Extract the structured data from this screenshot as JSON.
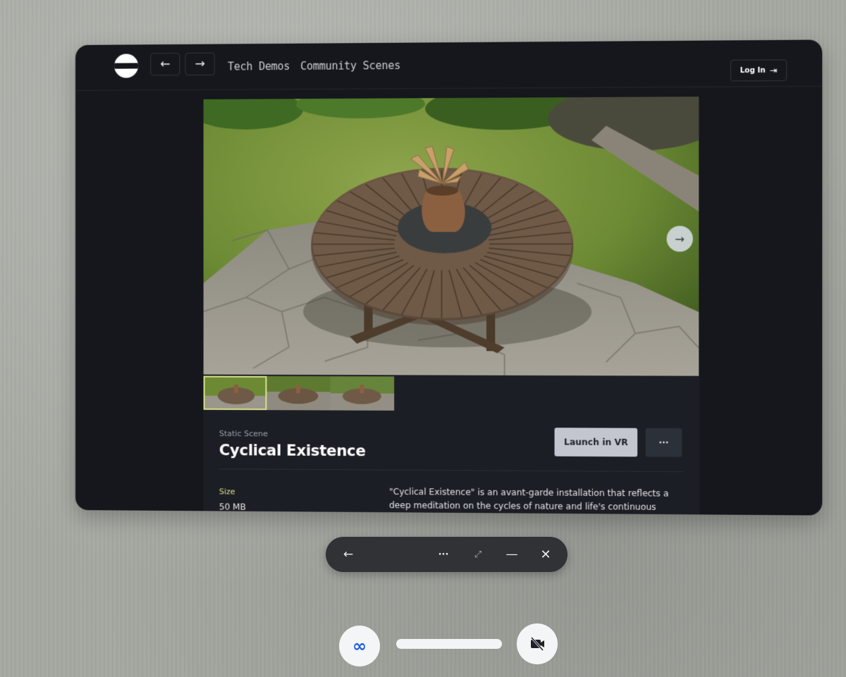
{
  "nav": {
    "back_icon": "←",
    "forward_icon": "→",
    "links": [
      "Tech Demos",
      "Community Scenes"
    ],
    "login_label": "Log In",
    "login_icon": "⇥"
  },
  "gallery": {
    "next_icon": "→",
    "thumbnail_count": 3,
    "selected_index": 0
  },
  "scene": {
    "type": "Static Scene",
    "title": "Cyclical Existence",
    "launch_label": "Launch in VR",
    "more_label": "···",
    "size_label": "Size",
    "size_value": "50 MB",
    "description": "\"Cyclical Existence\" is an avant-garde installation that reflects a deep meditation on the cycles of nature and life's continuous"
  },
  "window_controls": {
    "back_icon": "←",
    "more_icon": "···",
    "expand_icon": "⤢",
    "minimize_icon": "—",
    "close_icon": "✕"
  },
  "dock": {
    "meta_icon": "∞",
    "camera_icon": "camera-off-icon"
  },
  "colors": {
    "window_bg": "#15171c",
    "content_bg": "#1b1e24",
    "accent": "#d6e08a",
    "launch_button": "#c3c6cf"
  }
}
